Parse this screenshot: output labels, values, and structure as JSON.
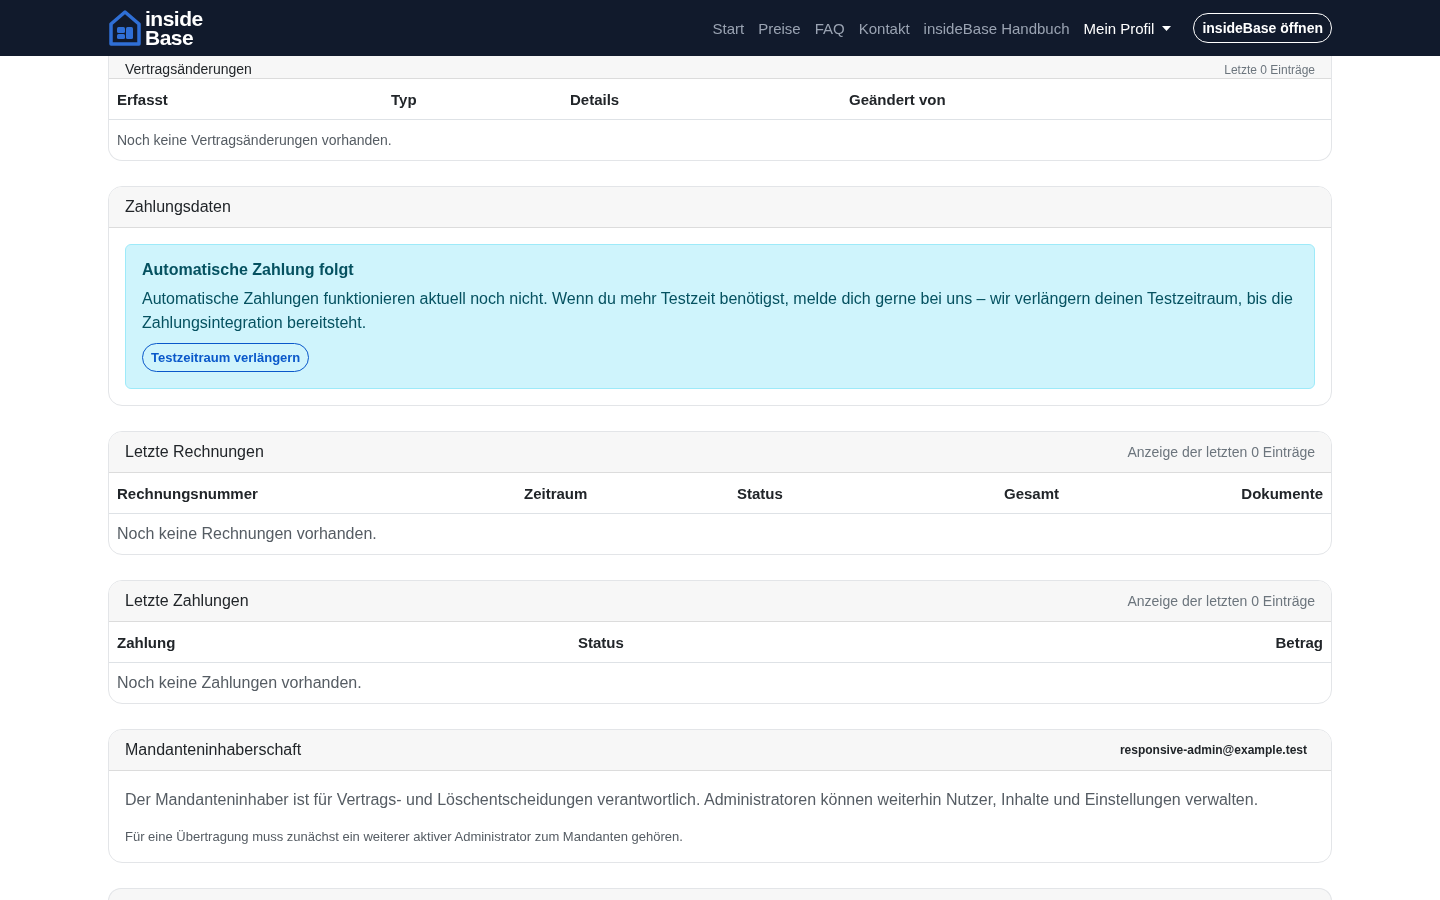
{
  "navbar": {
    "logo": {
      "line_1": "inside",
      "line_2": "Base"
    },
    "links": [
      {
        "label": "Start",
        "kind": "link"
      },
      {
        "label": "Preise",
        "kind": "link"
      },
      {
        "label": "FAQ",
        "kind": "link"
      },
      {
        "label": "Kontakt",
        "kind": "link"
      },
      {
        "label": "insideBase Handbuch",
        "kind": "link"
      },
      {
        "label": "Mein Profil",
        "kind": "dropdown"
      }
    ],
    "button": "insideBase öffnen"
  },
  "cards": [
    {
      "kind": "table",
      "title": "Vertragsänderungen",
      "meta": "Letzte 0 Einträge",
      "columns": [
        "Erfasst",
        "Typ",
        "Details",
        "Geändert von"
      ],
      "empty": "Noch keine Vertragsänderungen vorhanden."
    },
    {
      "kind": "alert",
      "title": "Zahlungsdaten",
      "alert": {
        "heading": "Automatische Zahlung folgt",
        "text": "Automatische Zahlungen funktionieren aktuell noch nicht. Wenn du mehr Testzeit benötigst, melde dich gerne bei uns – wir verlängern deinen Testzeitraum, bis die Zahlungsintegration bereitsteht.",
        "button": "Testzeitraum verlängern"
      }
    },
    {
      "kind": "table",
      "title": "Letzte Rechnungen",
      "meta": "Anzeige der letzten 0 Einträge",
      "columns": [
        "Rechnungsnummer",
        "Zeitraum",
        "Status",
        "Gesamt",
        "Dokumente"
      ],
      "empty": "Noch keine Rechnungen vorhanden."
    },
    {
      "kind": "table",
      "title": "Letzte Zahlungen",
      "meta": "Anzeige der letzten 0 Einträge",
      "columns": [
        "Zahlung",
        "Status",
        "Betrag"
      ],
      "empty": "Noch keine Zahlungen vorhanden."
    },
    {
      "kind": "text",
      "title": "Mandanteninhaberschaft",
      "owner": "responsive-admin@example.test",
      "text": "Der Mandanteninhaber ist für Vertrags- und Löschentscheidungen verantwortlich. Administratoren können weiterhin Nutzer, Inhalte und Einstellungen verwalten.",
      "note": "Für eine Übertragung muss zunächst ein weiterer aktiver Administrator zum Mandanten gehören."
    }
  ]
}
